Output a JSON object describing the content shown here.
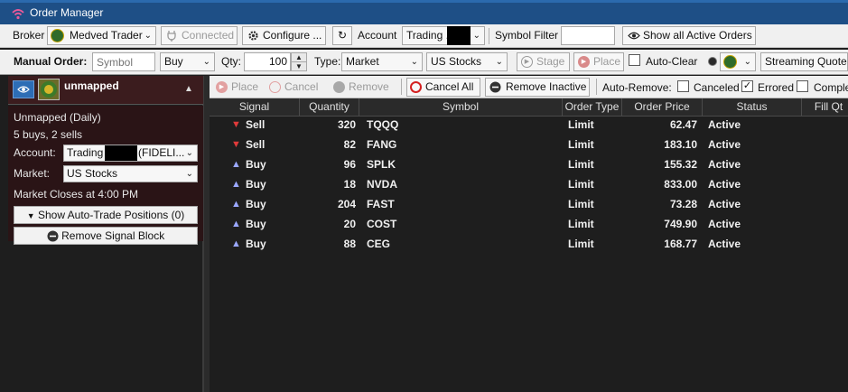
{
  "window": {
    "title": "Order Manager",
    "behind_title": ""
  },
  "toolbar1": {
    "broker_label": "Broker",
    "broker_value": "Medved Trader",
    "connected_label": "Connected",
    "configure_label": "Configure ...",
    "account_label": "Account",
    "account_value": "Trading ...",
    "symbol_filter_label": "Symbol Filter",
    "symbol_filter_value": "",
    "show_all_label": "Show all Active Orders"
  },
  "toolbar2": {
    "manual_order_label": "Manual Order:",
    "symbol_placeholder": "Symbol",
    "side_value": "Buy",
    "qty_label": "Qty:",
    "qty_value": "100",
    "type_label": "Type:",
    "type_value": "Market",
    "market_value": "US Stocks",
    "stage_label": "Stage",
    "place_label": "Place",
    "auto_clear_label": "Auto-Clear",
    "quote_source_value": "Streaming Quote"
  },
  "left_panel": {
    "name": "unmapped",
    "mode": "Unmapped (Daily)",
    "summary": "5 buys, 2 sells",
    "account_label": "Account:",
    "account_value_left": "Trading",
    "account_value_right": "(FIDELI...",
    "market_label": "Market:",
    "market_value": "US Stocks",
    "close_info": "Market Closes at 4:00 PM",
    "show_positions_label": "Show Auto-Trade Positions (0)",
    "remove_block_label": "Remove Signal Block"
  },
  "toolbar3": {
    "place_label": "Place",
    "cancel_label": "Cancel",
    "remove_label": "Remove",
    "cancel_all_label": "Cancel All",
    "remove_inactive_label": "Remove Inactive",
    "auto_remove_label": "Auto-Remove:",
    "canceled_label": "Canceled",
    "canceled_checked": false,
    "errored_label": "Errored",
    "errored_checked": true,
    "completed_label": "Comple"
  },
  "grid": {
    "columns": [
      "Signal",
      "Quantity",
      "Symbol",
      "Order Type",
      "Order Price",
      "Status",
      "Fill Qt"
    ],
    "rows": [
      {
        "signal": "Sell",
        "quantity": "320",
        "symbol": "TQQQ",
        "order_type": "Limit",
        "order_price": "62.47",
        "status": "Active"
      },
      {
        "signal": "Sell",
        "quantity": "82",
        "symbol": "FANG",
        "order_type": "Limit",
        "order_price": "183.10",
        "status": "Active"
      },
      {
        "signal": "Buy",
        "quantity": "96",
        "symbol": "SPLK",
        "order_type": "Limit",
        "order_price": "155.32",
        "status": "Active"
      },
      {
        "signal": "Buy",
        "quantity": "18",
        "symbol": "NVDA",
        "order_type": "Limit",
        "order_price": "833.00",
        "status": "Active"
      },
      {
        "signal": "Buy",
        "quantity": "204",
        "symbol": "FAST",
        "order_type": "Limit",
        "order_price": "73.28",
        "status": "Active"
      },
      {
        "signal": "Buy",
        "quantity": "20",
        "symbol": "COST",
        "order_type": "Limit",
        "order_price": "749.90",
        "status": "Active"
      },
      {
        "signal": "Buy",
        "quantity": "88",
        "symbol": "CEG",
        "order_type": "Limit",
        "order_price": "168.77",
        "status": "Active"
      }
    ]
  },
  "colors": {
    "titlebar": "#1e4f86",
    "sell": "#e03a3a",
    "buy": "#9ba8ff",
    "panel_header": "#3b1c1e"
  }
}
